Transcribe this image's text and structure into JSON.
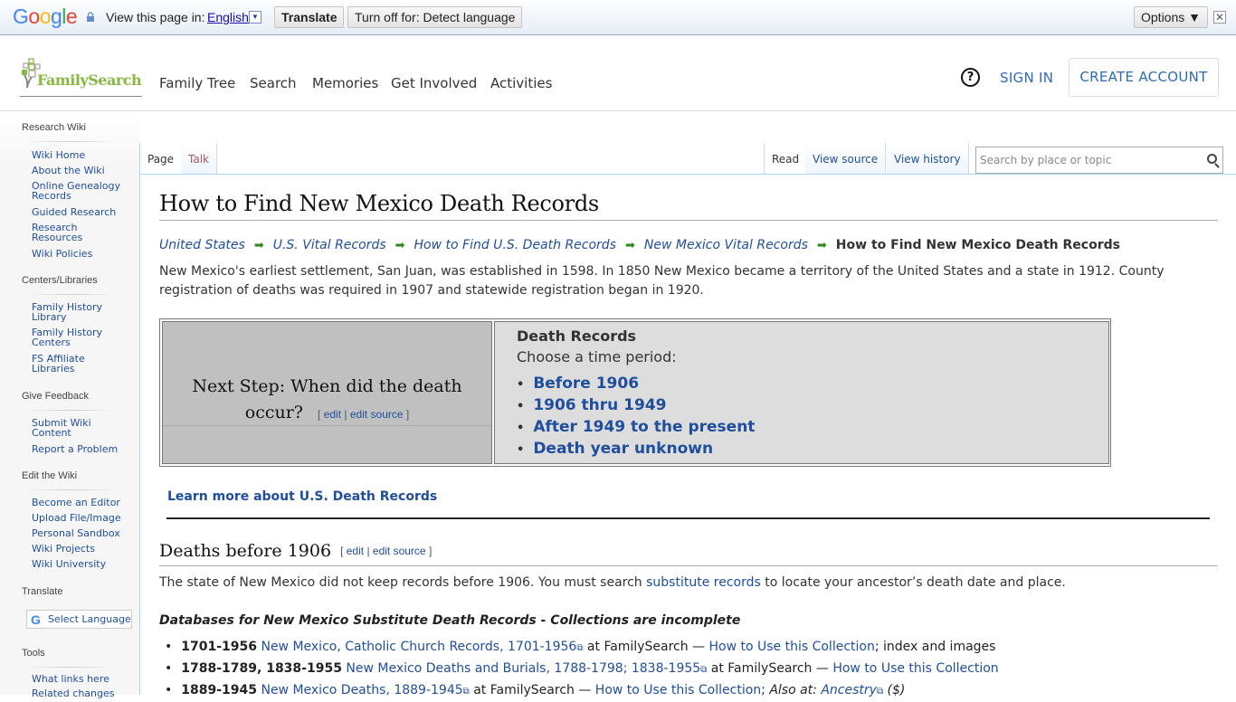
{
  "translate_bar": {
    "brand": "Google",
    "view_in_label": "View this page in:",
    "language": "English",
    "translate_button": "Translate",
    "turn_off_button": "Turn off for: Detect language",
    "options_button": "Options ▼",
    "close": "✕"
  },
  "header": {
    "logo_text": "FamilySearch",
    "nav": [
      "Family Tree",
      "Search",
      "Memories",
      "Get Involved",
      "Activities"
    ],
    "help": "?",
    "sign_in": "SIGN IN",
    "create_account": "CREATE ACCOUNT"
  },
  "sidebar": {
    "groups": [
      {
        "title": "Research Wiki",
        "items": [
          "Wiki Home",
          "About the Wiki",
          "Online Genealogy Records",
          "Guided Research",
          "Research Resources",
          "Wiki Policies"
        ]
      },
      {
        "title": "Centers/Libraries",
        "items": [
          "Family History Library",
          "Family History Centers",
          "FS Affiliate Libraries"
        ]
      },
      {
        "title": "Give Feedback",
        "items": [
          "Submit Wiki Content",
          "Report a Problem"
        ]
      },
      {
        "title": "Edit the Wiki",
        "items": [
          "Become an Editor",
          "Upload File/Image",
          "Personal Sandbox",
          "Wiki Projects",
          "Wiki University"
        ]
      },
      {
        "title": "Translate",
        "items": []
      },
      {
        "title": "Tools",
        "items": [
          "What links here",
          "Related changes"
        ]
      }
    ],
    "translate_select": "Select Language"
  },
  "tabs": {
    "page": "Page",
    "talk": "Talk",
    "read": "Read",
    "view_source": "View source",
    "view_history": "View history",
    "search_placeholder": "Search by place or topic"
  },
  "article": {
    "title": "How to Find New Mexico Death Records",
    "breadcrumbs": [
      "United States",
      "U.S. Vital Records",
      "How to Find U.S. Death Records",
      "New Mexico Vital Records"
    ],
    "breadcrumb_current": "How to Find New Mexico Death Records",
    "intro": "New Mexico's earliest settlement, San Juan, was established in 1598. In 1850 New Mexico became a territory of the United States and a state in 1912. County registration of deaths was required in 1907 and statewide registration began in 1920.",
    "next_step": "Next Step: When did the death occur?",
    "edit": "edit",
    "edit_source": "edit source",
    "death_records_title": "Death Records",
    "choose_period": "Choose a time period:",
    "periods": [
      "Before 1906",
      "1906 thru 1949",
      "After 1949 to the present",
      "Death year unknown"
    ],
    "learn_more": "Learn more about U.S. Death Records",
    "section_title": "Deaths before 1906",
    "section_text_before": "The state of New Mexico did not keep records before 1906. You must search ",
    "section_link": "substitute records",
    "section_text_after": " to locate your ancestor’s death date and place.",
    "db_heading": "Databases for New Mexico Substitute Death Records - Collections are incomplete",
    "databases": [
      {
        "years": "1701-1956",
        "title": "New Mexico, Catholic Church Records, 1701-1956",
        "at": " at FamilySearch — ",
        "howto": "How to Use this Collection",
        "tail": "; index and images"
      },
      {
        "years": "1788-1789, 1838-1955",
        "title": "New Mexico Deaths and Burials, 1788-1798; 1838-1955",
        "at": " at FamilySearch — ",
        "howto": "How to Use this Collection",
        "tail": ""
      },
      {
        "years": "1889-1945",
        "title": "New Mexico Deaths, 1889-1945",
        "at": " at FamilySearch — ",
        "howto": "How to Use this Collection",
        "tail": "; ",
        "also_at": "Also at:",
        "also_link": "Ancestry",
        "also_tail": " ($)"
      }
    ]
  }
}
